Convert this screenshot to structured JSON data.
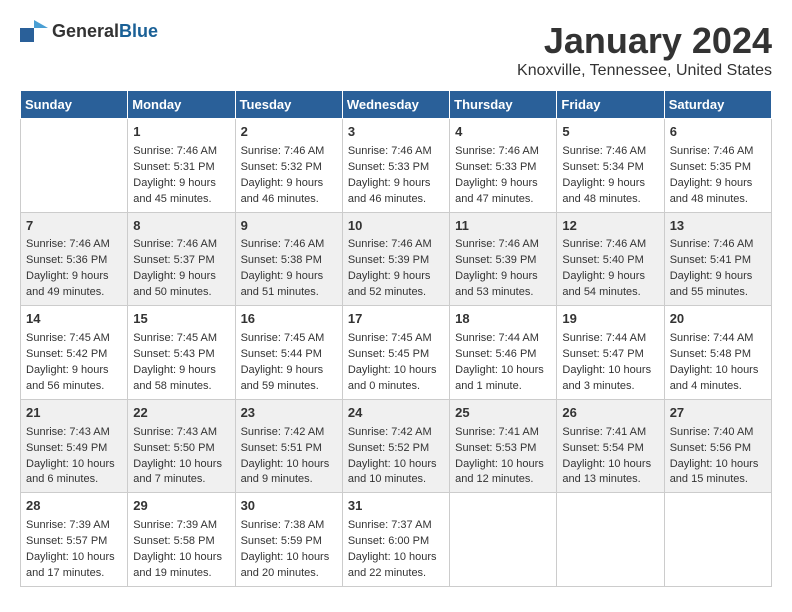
{
  "header": {
    "logo_general": "General",
    "logo_blue": "Blue",
    "title": "January 2024",
    "subtitle": "Knoxville, Tennessee, United States"
  },
  "calendar": {
    "days_of_week": [
      "Sunday",
      "Monday",
      "Tuesday",
      "Wednesday",
      "Thursday",
      "Friday",
      "Saturday"
    ],
    "weeks": [
      [
        {
          "day": "",
          "info": ""
        },
        {
          "day": "1",
          "info": "Sunrise: 7:46 AM\nSunset: 5:31 PM\nDaylight: 9 hours\nand 45 minutes."
        },
        {
          "day": "2",
          "info": "Sunrise: 7:46 AM\nSunset: 5:32 PM\nDaylight: 9 hours\nand 46 minutes."
        },
        {
          "day": "3",
          "info": "Sunrise: 7:46 AM\nSunset: 5:33 PM\nDaylight: 9 hours\nand 46 minutes."
        },
        {
          "day": "4",
          "info": "Sunrise: 7:46 AM\nSunset: 5:33 PM\nDaylight: 9 hours\nand 47 minutes."
        },
        {
          "day": "5",
          "info": "Sunrise: 7:46 AM\nSunset: 5:34 PM\nDaylight: 9 hours\nand 48 minutes."
        },
        {
          "day": "6",
          "info": "Sunrise: 7:46 AM\nSunset: 5:35 PM\nDaylight: 9 hours\nand 48 minutes."
        }
      ],
      [
        {
          "day": "7",
          "info": "Sunrise: 7:46 AM\nSunset: 5:36 PM\nDaylight: 9 hours\nand 49 minutes."
        },
        {
          "day": "8",
          "info": "Sunrise: 7:46 AM\nSunset: 5:37 PM\nDaylight: 9 hours\nand 50 minutes."
        },
        {
          "day": "9",
          "info": "Sunrise: 7:46 AM\nSunset: 5:38 PM\nDaylight: 9 hours\nand 51 minutes."
        },
        {
          "day": "10",
          "info": "Sunrise: 7:46 AM\nSunset: 5:39 PM\nDaylight: 9 hours\nand 52 minutes."
        },
        {
          "day": "11",
          "info": "Sunrise: 7:46 AM\nSunset: 5:39 PM\nDaylight: 9 hours\nand 53 minutes."
        },
        {
          "day": "12",
          "info": "Sunrise: 7:46 AM\nSunset: 5:40 PM\nDaylight: 9 hours\nand 54 minutes."
        },
        {
          "day": "13",
          "info": "Sunrise: 7:46 AM\nSunset: 5:41 PM\nDaylight: 9 hours\nand 55 minutes."
        }
      ],
      [
        {
          "day": "14",
          "info": "Sunrise: 7:45 AM\nSunset: 5:42 PM\nDaylight: 9 hours\nand 56 minutes."
        },
        {
          "day": "15",
          "info": "Sunrise: 7:45 AM\nSunset: 5:43 PM\nDaylight: 9 hours\nand 58 minutes."
        },
        {
          "day": "16",
          "info": "Sunrise: 7:45 AM\nSunset: 5:44 PM\nDaylight: 9 hours\nand 59 minutes."
        },
        {
          "day": "17",
          "info": "Sunrise: 7:45 AM\nSunset: 5:45 PM\nDaylight: 10 hours\nand 0 minutes."
        },
        {
          "day": "18",
          "info": "Sunrise: 7:44 AM\nSunset: 5:46 PM\nDaylight: 10 hours\nand 1 minute."
        },
        {
          "day": "19",
          "info": "Sunrise: 7:44 AM\nSunset: 5:47 PM\nDaylight: 10 hours\nand 3 minutes."
        },
        {
          "day": "20",
          "info": "Sunrise: 7:44 AM\nSunset: 5:48 PM\nDaylight: 10 hours\nand 4 minutes."
        }
      ],
      [
        {
          "day": "21",
          "info": "Sunrise: 7:43 AM\nSunset: 5:49 PM\nDaylight: 10 hours\nand 6 minutes."
        },
        {
          "day": "22",
          "info": "Sunrise: 7:43 AM\nSunset: 5:50 PM\nDaylight: 10 hours\nand 7 minutes."
        },
        {
          "day": "23",
          "info": "Sunrise: 7:42 AM\nSunset: 5:51 PM\nDaylight: 10 hours\nand 9 minutes."
        },
        {
          "day": "24",
          "info": "Sunrise: 7:42 AM\nSunset: 5:52 PM\nDaylight: 10 hours\nand 10 minutes."
        },
        {
          "day": "25",
          "info": "Sunrise: 7:41 AM\nSunset: 5:53 PM\nDaylight: 10 hours\nand 12 minutes."
        },
        {
          "day": "26",
          "info": "Sunrise: 7:41 AM\nSunset: 5:54 PM\nDaylight: 10 hours\nand 13 minutes."
        },
        {
          "day": "27",
          "info": "Sunrise: 7:40 AM\nSunset: 5:56 PM\nDaylight: 10 hours\nand 15 minutes."
        }
      ],
      [
        {
          "day": "28",
          "info": "Sunrise: 7:39 AM\nSunset: 5:57 PM\nDaylight: 10 hours\nand 17 minutes."
        },
        {
          "day": "29",
          "info": "Sunrise: 7:39 AM\nSunset: 5:58 PM\nDaylight: 10 hours\nand 19 minutes."
        },
        {
          "day": "30",
          "info": "Sunrise: 7:38 AM\nSunset: 5:59 PM\nDaylight: 10 hours\nand 20 minutes."
        },
        {
          "day": "31",
          "info": "Sunrise: 7:37 AM\nSunset: 6:00 PM\nDaylight: 10 hours\nand 22 minutes."
        },
        {
          "day": "",
          "info": ""
        },
        {
          "day": "",
          "info": ""
        },
        {
          "day": "",
          "info": ""
        }
      ]
    ]
  }
}
